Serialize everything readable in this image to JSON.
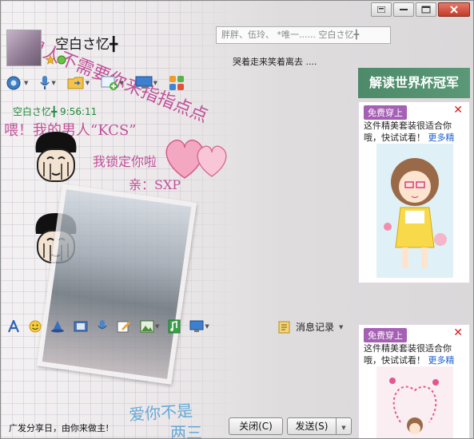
{
  "header": {
    "nickname": "空白さ忆╋",
    "signature_placeholder": "胖胖、伍玲、   *唯一......    空白さ忆╋",
    "sub_status": "哭着走来笑着离去 ...."
  },
  "chat": {
    "sender_time": "空白さ忆╋  9:56:11"
  },
  "skin_text": {
    "top_arc": "的男人不需要你来指指点点",
    "line1": "喂！我的男人“KCS”",
    "line2": "我锁定你啦",
    "line3": "亲：SXP",
    "bottom": "爱你不是",
    "bottom2": "两三"
  },
  "input_bar": {
    "history_label": "消息记录"
  },
  "footer": {
    "promo_text": "广发分享日，由你来做主!",
    "close_label": "关闭(C)",
    "send_label": "发送(S)"
  },
  "ads": {
    "banner": "解读世界杯冠军",
    "card1": {
      "tag": "免费穿上",
      "text": "这件精美套装很适合你哦，快试试看！",
      "more": "更多精"
    },
    "card2": {
      "tag": "免费穿上",
      "text": "这件精美套装很适合你哦，快试试看！",
      "more": "更多精"
    }
  }
}
